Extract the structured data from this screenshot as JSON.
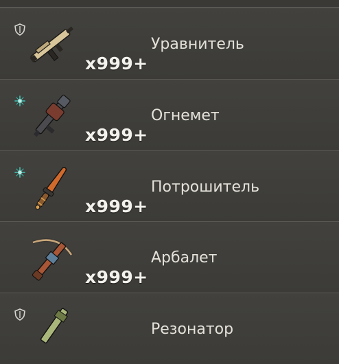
{
  "items": [
    {
      "name": "Уравнитель",
      "count": "x999+",
      "badge": "shield-icon",
      "badge_color": "#d8d6d0"
    },
    {
      "name": "Огнемет",
      "count": "x999+",
      "badge": "plus-burst-icon",
      "badge_color": "#3fb2a6"
    },
    {
      "name": "Потрошитель",
      "count": "x999+",
      "badge": "plus-burst-icon",
      "badge_color": "#3fb2a6"
    },
    {
      "name": "Арбалет",
      "count": "x999+",
      "badge": "",
      "badge_color": ""
    },
    {
      "name": "Резонатор",
      "count": "",
      "badge": "shield-icon",
      "badge_color": "#d8d6d0"
    }
  ]
}
